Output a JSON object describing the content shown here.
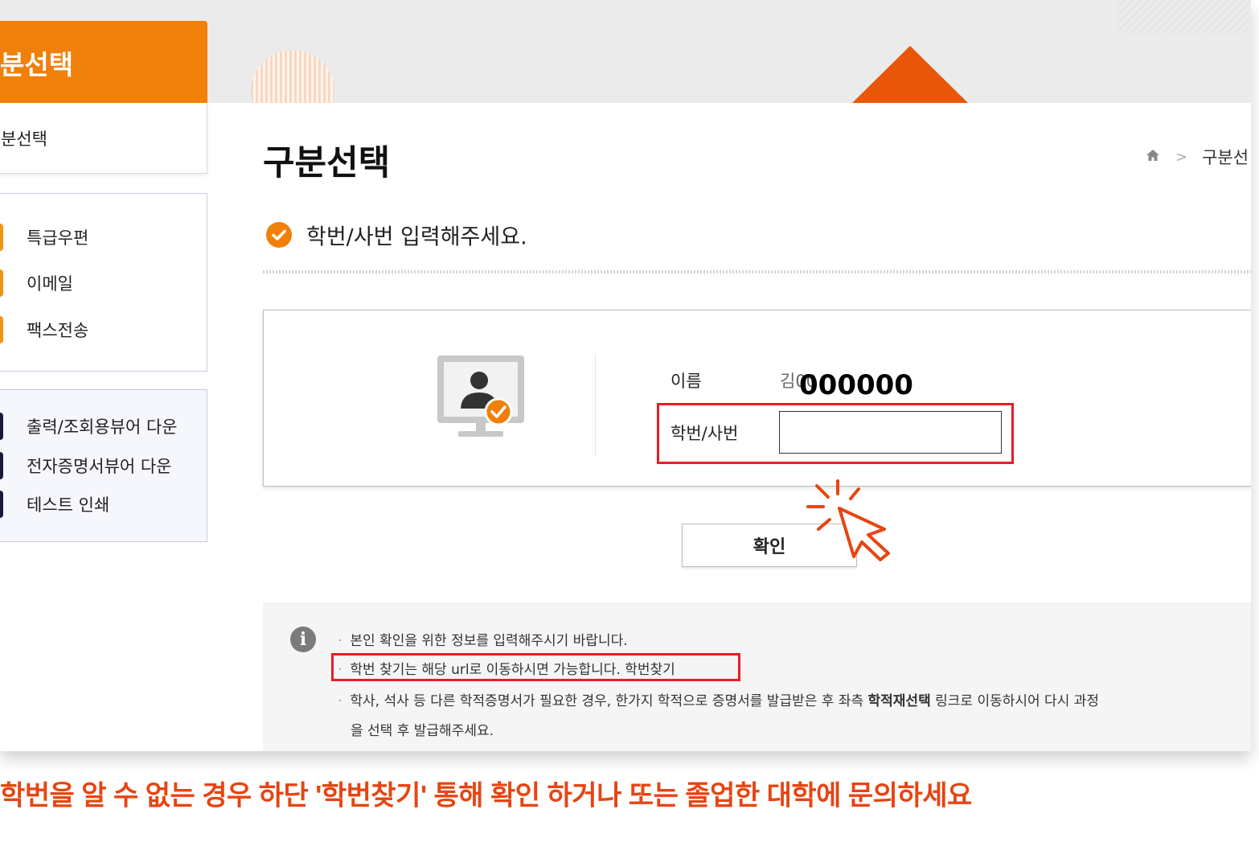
{
  "sidebar": {
    "header_title": "분선택",
    "sub_item": "분선택",
    "delivery_items": [
      {
        "label": "특급우편"
      },
      {
        "label": "이메일"
      },
      {
        "label": "팩스전송"
      }
    ],
    "download_items": [
      {
        "label": "출력/조회용뷰어 다운"
      },
      {
        "label": "전자증명서뷰어 다운"
      },
      {
        "label": "테스트 인쇄"
      }
    ]
  },
  "main": {
    "page_title": "구분선택",
    "breadcrumb": {
      "current": "구분선"
    },
    "prompt": "학번/사번 입력해주세요.",
    "form": {
      "name_label": "이름",
      "name_value": "김00",
      "overlay_number": "000000",
      "id_label": "학번/사번",
      "id_value": "",
      "confirm_label": "확인"
    },
    "notices": [
      "본인 확인을 위한 정보를 입력해주시기 바랍니다.",
      "학번 찾기는 해당 url로 이동하시면 가능합니다. 학번찾기",
      "학사, 석사 등 다른 학적증명서가 필요한 경우, 한가지 학적으로 증명서를 발급받은 후 좌측",
      "학적재선택",
      "링크로 이동하시어 다시 과정",
      "을 선택 후 발급해주세요."
    ]
  },
  "caption": "학번을 알 수 없는 경우 하단 '학번찾기' 통해 확인 하거나 또는 졸업한 대학에 문의하세요",
  "colors": {
    "accent_orange": "#f0800a",
    "highlight_red": "#ea1c24",
    "caption_red": "#e64512",
    "navy": "#161b3b"
  },
  "icons": [
    "home-icon",
    "check-circle-icon",
    "user-monitor-icon",
    "info-icon",
    "pointer-cursor-icon"
  ]
}
